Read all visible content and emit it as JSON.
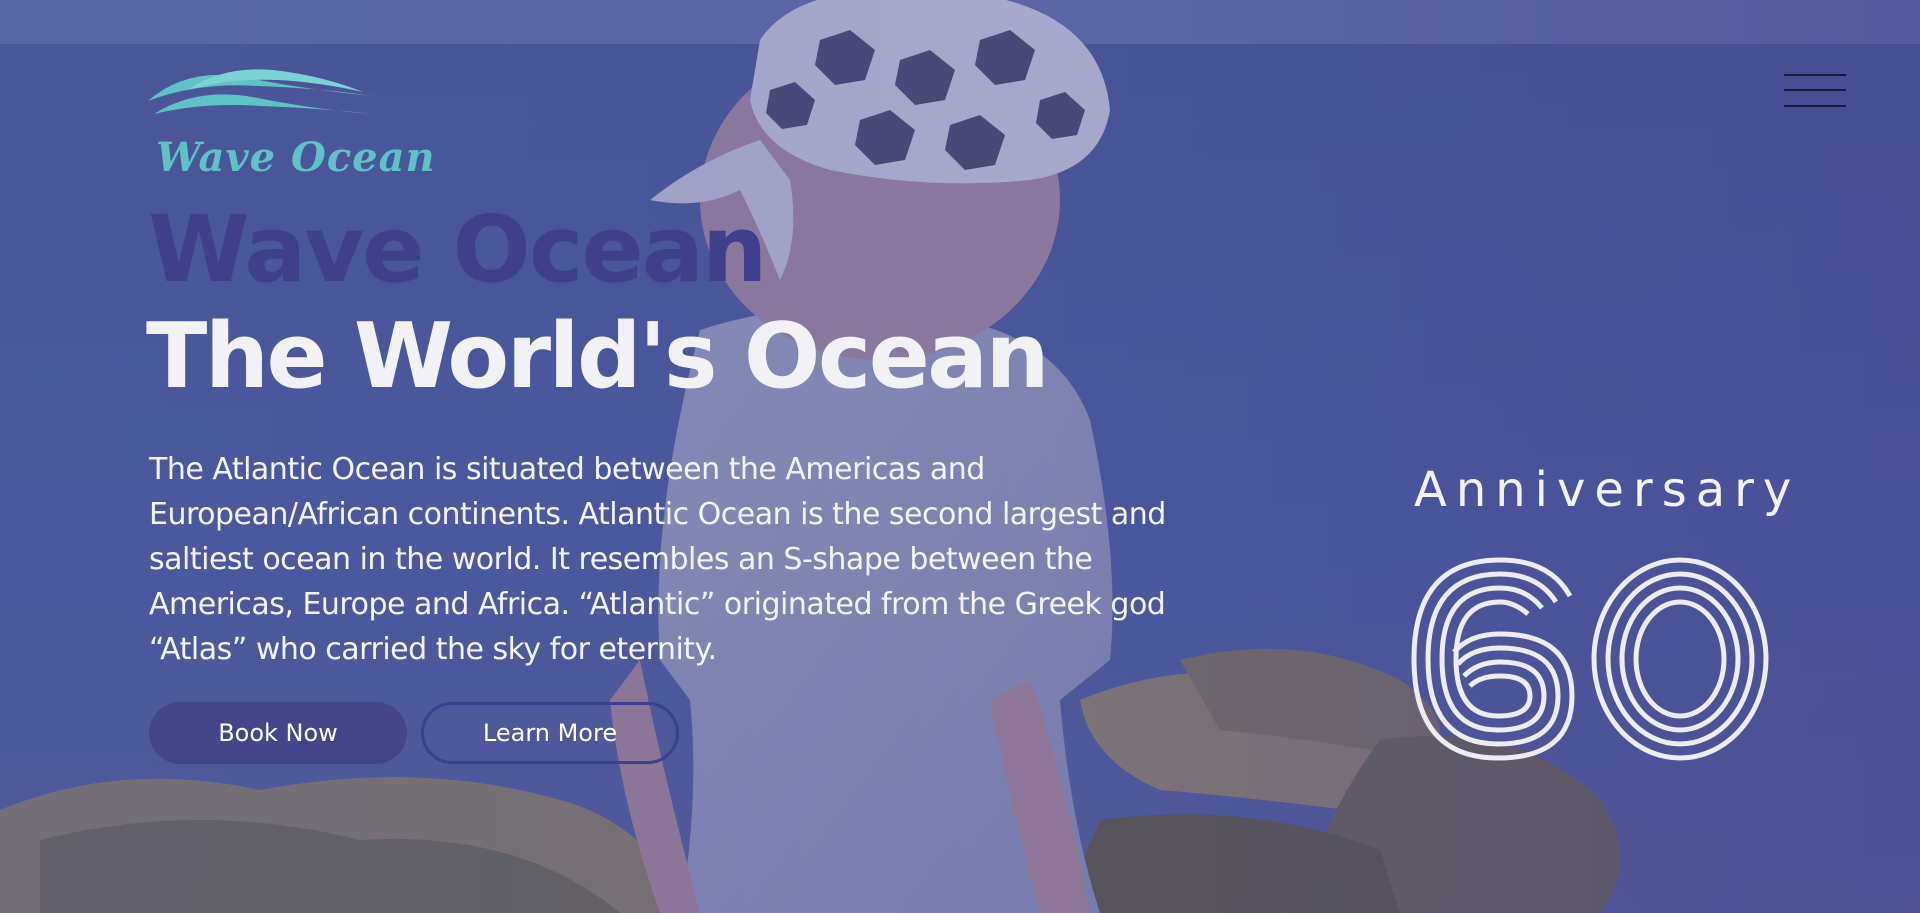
{
  "header": {
    "logo": {
      "text": "Wave Ocean",
      "color": "#5ec2c6"
    },
    "menu_icon": "hamburger-menu-icon"
  },
  "hero": {
    "brand_heading": "Wave Ocean",
    "title": "The World's Ocean",
    "description": "The Atlantic Ocean is situated between the Americas and European/African continents. Atlantic Ocean is the second largest and saltiest ocean in the world. It resembles an S-shape between the Americas, Europe and Africa. “Atlantic” originated from the Greek god “Atlas” who carried the sky for eternity.",
    "buttons": {
      "book_now": "Book Now",
      "learn_more": "Learn More"
    }
  },
  "anniversary": {
    "label": "Anniversary",
    "number": "60"
  },
  "colors": {
    "accent": "#45458a",
    "brand_heading": "#3f3f8c",
    "logo": "#5ec2c6",
    "text": "#f2f2f6"
  }
}
